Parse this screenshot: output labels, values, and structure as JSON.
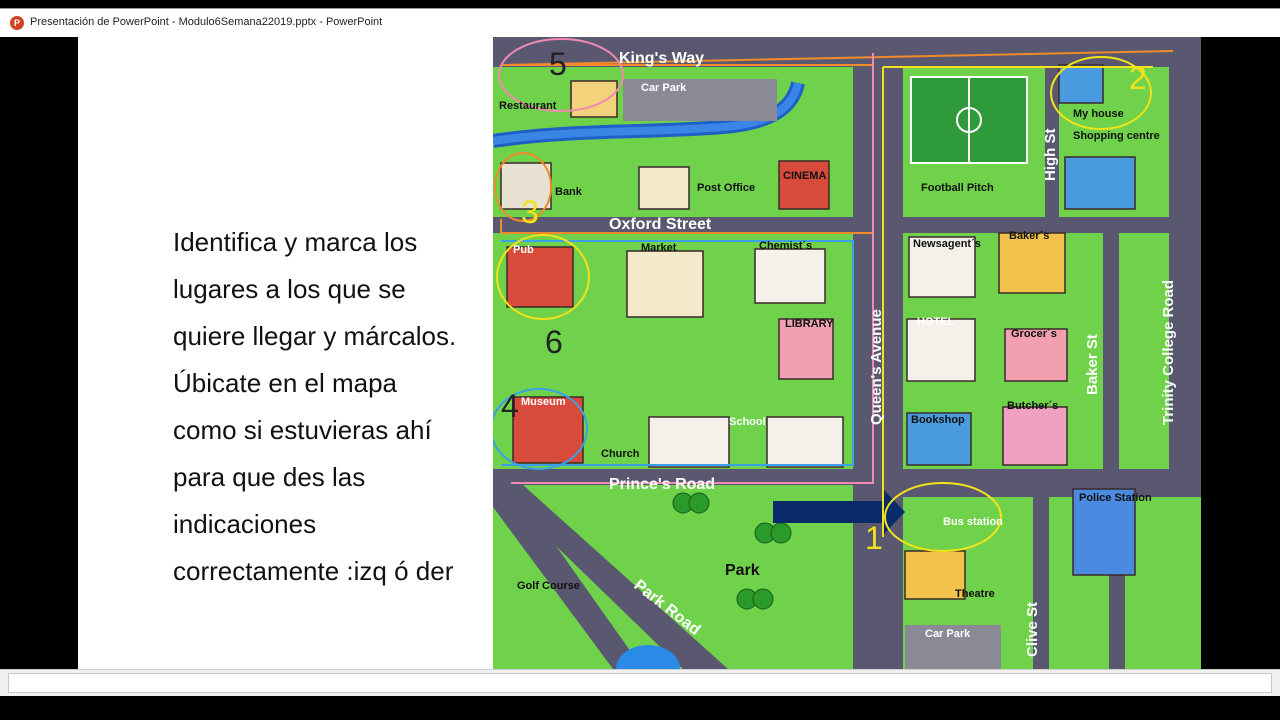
{
  "window": {
    "title": "Presentación de PowerPoint  -  Modulo6Semana22019.pptx - PowerPoint",
    "icon": "powerpoint-icon"
  },
  "slide": {
    "instructions": "Identifica y marca los\nlugares a los que se\nquiere llegar y márcalos.\nÚbicate en el mapa\ncomo si estuvieras ahí\npara que des las\nindicaciones\ncorrectamente :izq ó der"
  },
  "map": {
    "streets": {
      "kings_way": "King's Way",
      "oxford_street": "Oxford Street",
      "princes_road": "Prince's Road",
      "park_road": "Park Road",
      "queens_avenue": "Queen's Avenue",
      "high_st": "High St",
      "baker_st": "Baker St",
      "trinity_college_road": "Trinity College Road",
      "clive_st": "Clive St"
    },
    "places": {
      "restaurant": "Restaurant",
      "car_park_top": "Car Park",
      "bank": "Bank",
      "post_office": "Post Office",
      "cinema": "CINEMA",
      "football_pitch": "Football Pitch",
      "my_house": "My house",
      "shopping_centre": "Shopping centre",
      "pub": "Pub",
      "market": "Market",
      "chemists": "Chemist´s",
      "library": "LIBRARY",
      "newsagents": "Newsagent´s",
      "bakers": "Baker´s",
      "hotel": "HOTEL",
      "grocers": "Grocer´s",
      "museum": "Museum",
      "church": "Church",
      "school": "School",
      "bookshop": "Bookshop",
      "butchers": "Butcher´s",
      "bus_station": "Bus station",
      "police_station": "Police Station",
      "golf_course": "Golf Course",
      "park": "Park",
      "theatre": "Theatre",
      "car_park_bottom": "Car Park"
    },
    "markers": [
      "1",
      "2",
      "3",
      "4",
      "5",
      "6"
    ],
    "colors": {
      "road": "#5a5870",
      "grass": "#6fd24a",
      "river": "#2a6fd6",
      "arrow": "#0a2a6a",
      "pen_orange": "#f08a2a",
      "pen_yellow": "#f2e21a",
      "pen_pink": "#f08ab0",
      "pen_blue": "#3aa0e8"
    }
  }
}
